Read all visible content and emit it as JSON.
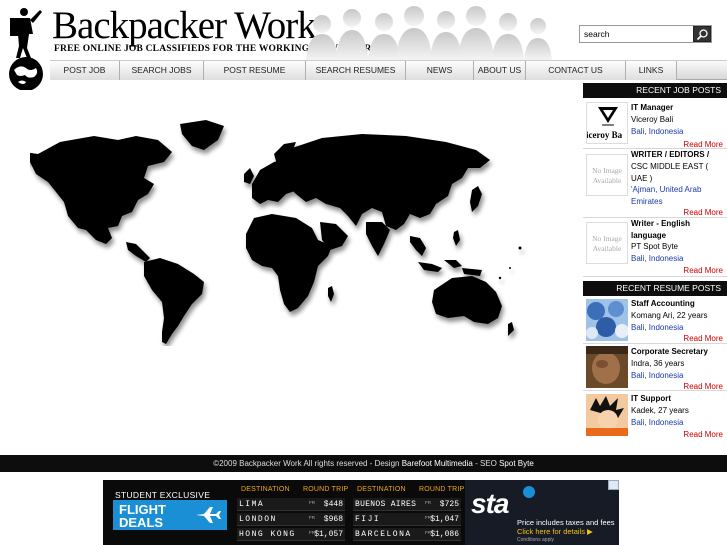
{
  "header": {
    "site_title": "Backpacker Work",
    "tagline": "FREE ONLINE JOB CLASSIFIEDS FOR THE WORKING TRAVELLER",
    "search_value": "search"
  },
  "nav": {
    "items": [
      {
        "label": "POST JOB"
      },
      {
        "label": "SEARCH JOBS"
      },
      {
        "label": "POST RESUME"
      },
      {
        "label": "SEARCH RESUMES"
      },
      {
        "label": "NEWS"
      },
      {
        "label": "ABOUT US"
      },
      {
        "label": "CONTACT US"
      },
      {
        "label": "LINKS"
      }
    ]
  },
  "sidebar": {
    "job_heading": "RECENT JOB POSTS",
    "jobs": [
      {
        "title": "IT Manager",
        "company": "Viceroy Bali",
        "location": "Bali, Indonesia",
        "more": "Read More",
        "thumb_text": "iceroy Ba"
      },
      {
        "title": "WRITER / EDITORS /",
        "company": "CSC MIDDLE EAST ( UAE )",
        "location": "'Ajman, United Arab Emirates",
        "more": "Read More",
        "thumb_text": "No Image Available"
      },
      {
        "title": "Writer - English language",
        "company": "PT Spot Byte",
        "location": "Bali, Indonesia",
        "more": "Read More",
        "thumb_text": "No Image Available"
      }
    ],
    "resume_heading": "RECENT RESUME POSTS",
    "resumes": [
      {
        "title": "Staff Accounting",
        "person": "Komang Ari, 22 years",
        "location": "Bali, Indonesia",
        "more": "Read More"
      },
      {
        "title": "Corporate Secretary",
        "person": "Indra, 36 years",
        "location": "Bali, Indonesia",
        "more": "Read More"
      },
      {
        "title": "IT Support",
        "person": "Kadek, 27 years",
        "location": "Bali, Indonesia",
        "more": "Read More"
      }
    ]
  },
  "footer": {
    "copyright": "©2009 Backpacker Work All rights reserved - Design ",
    "design_link": "Barefoot Multimedia",
    "seo_text": " - SEO ",
    "seo_link": "Spot Byte"
  },
  "ad": {
    "exclusive": "STUDENT EXCLUSIVE",
    "deals_line1": "FLIGHT",
    "deals_line2": "DEALS",
    "col_destination": "DESTINATION",
    "col_round_trip": "ROUND TRIP",
    "fr_label": "FR",
    "board1": [
      {
        "city": "LIMA",
        "price": "$448"
      },
      {
        "city": "LONDON",
        "price": "$968"
      },
      {
        "city": "HONG KONG",
        "price": "$1,057"
      }
    ],
    "board2": [
      {
        "city": "BUENOS AIRES",
        "price": "$725"
      },
      {
        "city": "FIJI",
        "price": "$1,047"
      },
      {
        "city": "BARCELONA",
        "price": "$1,086"
      }
    ],
    "brand": "sta",
    "price_note": "Price includes taxes and fees",
    "click": "Click here for details ▶",
    "conditions": "Conditions apply"
  }
}
